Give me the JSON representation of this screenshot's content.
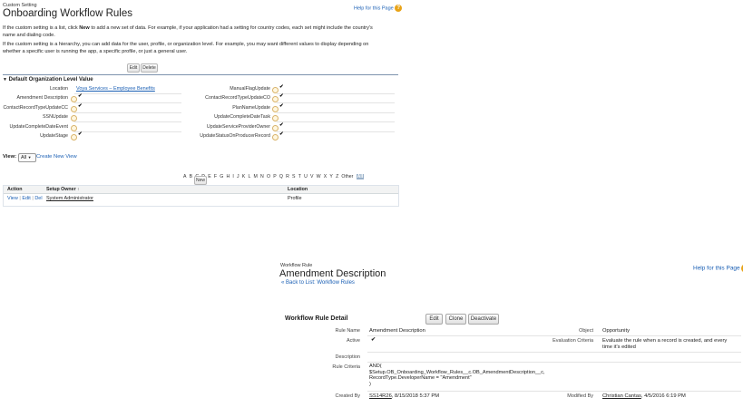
{
  "custom_setting": {
    "breadcrumb": "Custom Setting",
    "title": "Onboarding Workflow Rules",
    "help_link": "Help for this Page",
    "desc1_a": "If the custom setting is a list, click ",
    "desc1_b": "New",
    "desc1_c": " to add a new set of data. For example, if your application had a setting for country codes, each set might include the country's",
    "desc1_d": "name and dialing code.",
    "desc2_a": "If the custom setting is a hierarchy, you can add data for the user, profile, or organization level. For example, you may want different values to display depending on",
    "desc2_b": "whether a specific user is running the app, a specific profile, or just a general user.",
    "edit_button": "Edit",
    "delete_button": "Delete",
    "section_title": "Default Organization Level Value",
    "left_fields": [
      {
        "label": "Location",
        "value": "Voya Services – Employee Benefits",
        "help": false
      },
      {
        "label": "Amendment Description",
        "value": "✔",
        "help": true
      },
      {
        "label": "ContactRecordTypeUpdateCC",
        "value": "✔",
        "help": true
      },
      {
        "label": "SSNUpdate",
        "value": "",
        "help": true
      },
      {
        "label": "UpdateCompleteDateEvent",
        "value": "",
        "help": true
      },
      {
        "label": "UpdateStage",
        "value": "✔",
        "help": true
      }
    ],
    "right_fields": [
      {
        "label": "ManualFlagUpdate",
        "value": "✔"
      },
      {
        "label": "ContactRecordTypeUpdateCO",
        "value": "✔"
      },
      {
        "label": "PlanNameUpdate",
        "value": "✔"
      },
      {
        "label": "UpdateCompleteDateTask",
        "value": ""
      },
      {
        "label": "UpdateServiceProviderOwner",
        "value": "✔"
      },
      {
        "label": "UpdateStatusOnProducerRecord",
        "value": "✔"
      }
    ],
    "view_label": "View:",
    "view_selected": "All",
    "create_view": "Create New View",
    "alphabet": [
      "A",
      "B",
      "C",
      "D",
      "E",
      "F",
      "G",
      "H",
      "I",
      "J",
      "K",
      "L",
      "M",
      "N",
      "O",
      "P",
      "Q",
      "R",
      "S",
      "T",
      "U",
      "V",
      "W",
      "X",
      "Y",
      "Z",
      "Other",
      "All"
    ],
    "new_button": "New",
    "table_headers": {
      "action": "Action",
      "owner": "Setup Owner",
      "sort_arrow": "↑",
      "location": "Location"
    },
    "table_row": {
      "view": "View",
      "edit": "Edit",
      "del": "Del",
      "sep": "|",
      "owner": "System Administrator",
      "location": "Profile"
    }
  },
  "workflow": {
    "breadcrumb": "Workflow Rule",
    "title": "Amendment Description",
    "back_link": "« Back to List: Workflow Rules",
    "help_link": "Help for this Page",
    "detail_title": "Workflow Rule Detail",
    "edit_button": "Edit",
    "clone_button": "Clone",
    "deactivate_button": "Deactivate",
    "rule_name_label": "Rule Name",
    "rule_name": "Amendment Description",
    "object_label": "Object",
    "object": "Opportunity",
    "active_label": "Active",
    "active": "✔",
    "eval_label": "Evaluation Criteria",
    "eval_1": "Evaluate the rule when a record is created, and every",
    "eval_2": "time it's edited",
    "description_label": "Description",
    "criteria_label": "Rule Criteria",
    "criteria_1": "AND(",
    "criteria_2": "$Setup.OB_Onboarding_Workflow_Rules__c.OB_AmendmentDescription__c,",
    "criteria_3": "RecordType.DeveloperName = \"Amendment\"",
    "criteria_4": ")",
    "created_label": "Created By",
    "created_by": "SS14R26",
    "created_date": ", 8/15/2018 5:37 PM",
    "modified_label": "Modified By",
    "modified_by": "Christian Cantas",
    "modified_date": ", 4/5/2016 6:19 PM"
  }
}
